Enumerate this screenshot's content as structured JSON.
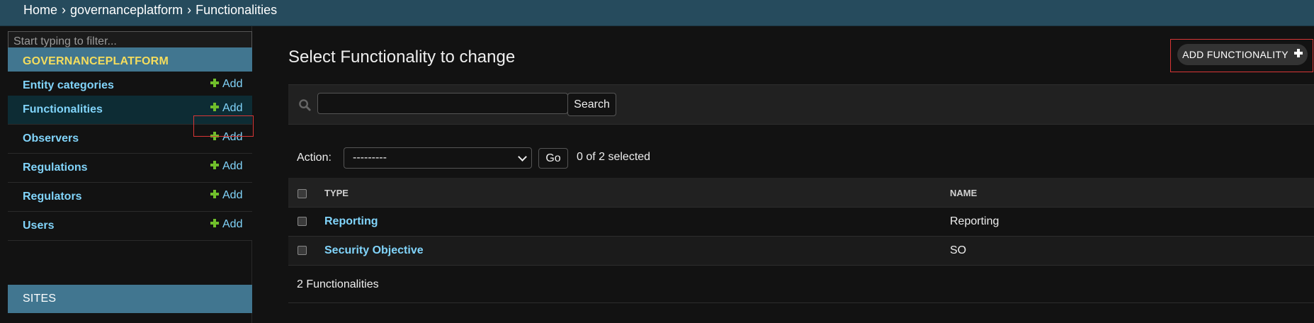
{
  "breadcrumbs": {
    "home": "Home",
    "app": "governanceplatform",
    "current": "Functionalities",
    "separator": "›"
  },
  "sidebar": {
    "filter_placeholder": "Start typing to filter...",
    "module_title": "GOVERNANCEPLATFORM",
    "add_label": "Add",
    "items": [
      {
        "label": "Entity categories"
      },
      {
        "label": "Functionalities"
      },
      {
        "label": "Observers"
      },
      {
        "label": "Regulations"
      },
      {
        "label": "Regulators"
      },
      {
        "label": "Users"
      }
    ],
    "sites_title": "SITES"
  },
  "main": {
    "title": "Select Functionality to change",
    "add_button": "ADD FUNCTIONALITY",
    "search": {
      "value": "",
      "button": "Search"
    },
    "actions": {
      "label": "Action:",
      "selected_option": "---------",
      "go_button": "Go",
      "selected_count": "0 of 2 selected"
    },
    "table": {
      "headers": [
        "TYPE",
        "NAME"
      ],
      "rows": [
        {
          "type": "Reporting",
          "name": "Reporting"
        },
        {
          "type": "Security Objective",
          "name": "SO"
        }
      ]
    },
    "paginator": "2 Functionalities"
  },
  "colors": {
    "header_bg": "#264b5d",
    "module_bg": "#417690",
    "module_text": "#f5dd5d",
    "link": "#81d4fa",
    "add_icon": "#70bf2b",
    "highlight": "#d93636"
  }
}
